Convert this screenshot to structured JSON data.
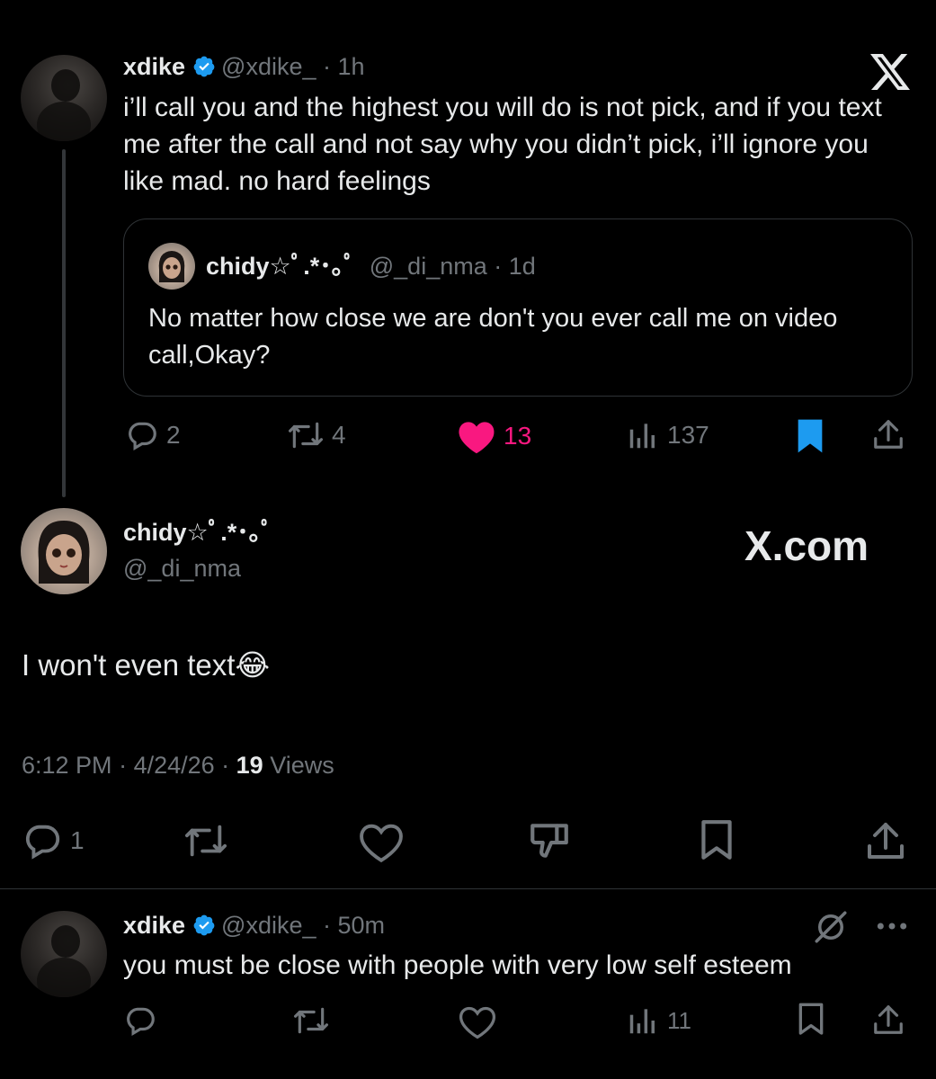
{
  "colors": {
    "background": "#000000",
    "text": "#e7e9ea",
    "muted": "#71767b",
    "verified": "#1d9bf0",
    "like": "#f91880",
    "bookmark": "#1d9bf0"
  },
  "tweet1": {
    "name": "xdike",
    "handle": "@xdike_",
    "time": "· 1h",
    "text": "i’ll call you and the highest you will do is not pick, and if you text me after the call and not say why you didn’t pick, i’ll ignore you like mad. no hard feelings",
    "quote": {
      "name": "chidy☆ﾟ.*･｡ﾟ",
      "handle": "@_di_nma",
      "time": "· 1d",
      "text": "No matter how close we are don't you ever call me on video call,Okay?"
    },
    "replies": "2",
    "reposts": "4",
    "likes": "13",
    "views": "137",
    "bookmarked": true,
    "liked": true
  },
  "x_logo_icon": "x-logo-icon",
  "main_tweet": {
    "name": "chidy☆ﾟ.*･｡ﾟ",
    "handle": "@_di_nma",
    "watermark": "X.com",
    "text": "I won't even text",
    "emoji": "😂",
    "time": "6:12 PM",
    "date": "4/24/26",
    "views_count": "19",
    "views_label": "Views",
    "replies": "1"
  },
  "reply_tweet": {
    "name": "xdike",
    "handle": "@xdike_",
    "time": "· 50m",
    "text": "you must be close with people with very low self esteem",
    "views": "11"
  }
}
